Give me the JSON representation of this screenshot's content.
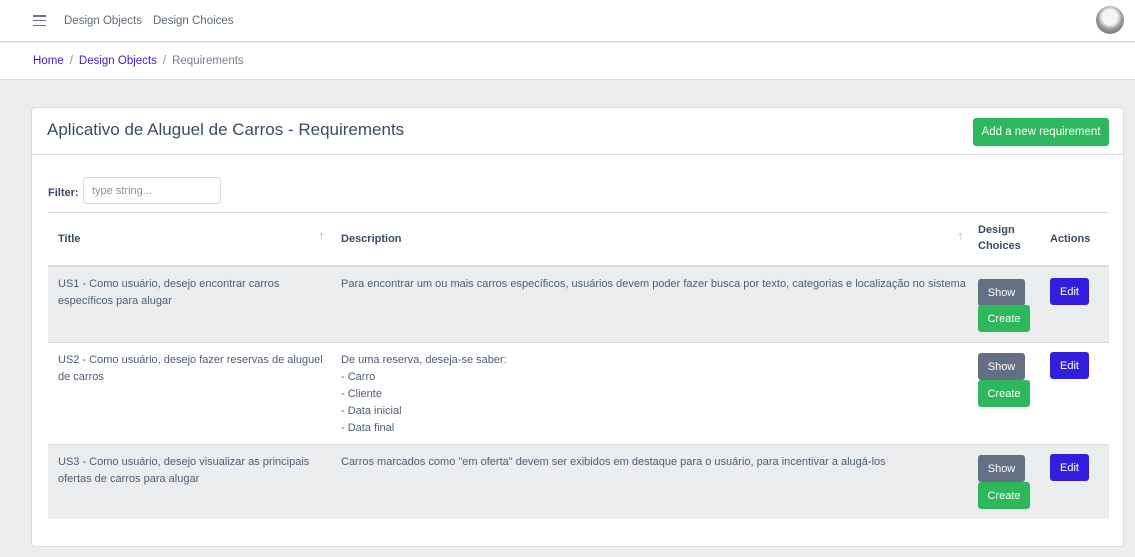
{
  "topbar": {
    "nav": [
      "Design Objects",
      "Design Choices"
    ]
  },
  "breadcrumb": {
    "home": "Home",
    "design_objects": "Design Objects",
    "current": "Requirements"
  },
  "card": {
    "title": "Aplicativo de Aluguel de Carros - Requirements",
    "add_button": "Add a new requirement"
  },
  "filter": {
    "label": "Filter:",
    "value": "",
    "placeholder": "type string..."
  },
  "table": {
    "columns": {
      "title": "Title",
      "description": "Description",
      "design_choices_1": "Design",
      "design_choices_2": "Choices",
      "actions": "Actions"
    },
    "rows": [
      {
        "title_1": "US1 - Como usuário, desejo encontrar carros",
        "title_2": "específicos para alugar",
        "description": [
          "Para encontrar um ou mais carros específicos, usuários devem poder fazer busca por texto, categorias e localização no sistema"
        ],
        "show": "Show",
        "create": "Create",
        "edit": "Edit"
      },
      {
        "title_1": "US2 - Como usuário, desejo fazer reservas de aluguel",
        "title_2": "de carros",
        "description": [
          "De uma reserva, deseja-se saber:",
          "- Carro",
          "- Cliente",
          "- Data inicial",
          "- Data final"
        ],
        "show": "Show",
        "create": "Create",
        "edit": "Edit"
      },
      {
        "title_1": "US3 - Como usuário, desejo visualizar as principais",
        "title_2": "ofertas de carros para alugar",
        "description": [
          "Carros marcados como \"em oferta\" devem ser exibidos em destaque para o usuário, para incentivar a alugá-los"
        ],
        "show": "Show",
        "create": "Create",
        "edit": "Edit"
      }
    ]
  },
  "icons": {
    "menu": "hamburger-icon",
    "sort": "arrow-up-icon"
  }
}
